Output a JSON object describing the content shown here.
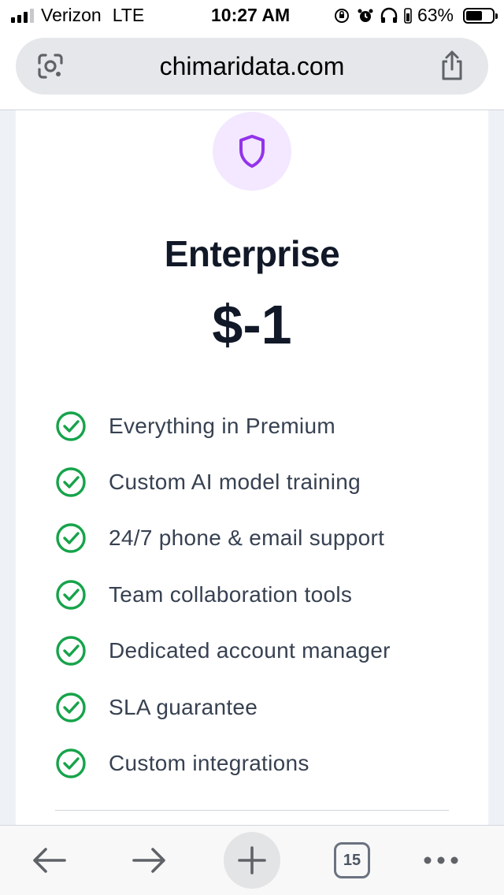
{
  "status_bar": {
    "carrier": "Verizon",
    "network": "LTE",
    "time": "10:27 AM",
    "battery_percent": "63%",
    "battery_level": 0.63
  },
  "browser": {
    "url": "chimaridata.com",
    "tab_count": "15"
  },
  "plan": {
    "icon": "shield-icon",
    "title": "Enterprise",
    "price": "$-1",
    "features": [
      "Everything in Premium",
      "Custom AI model training",
      "24/7 phone & email support",
      "Team collaboration tools",
      "Dedicated account manager",
      "SLA guarantee",
      "Custom integrations"
    ]
  },
  "colors": {
    "accent_purple": "#9333ea",
    "icon_bg": "#f3e8ff",
    "check_green": "#16a34a",
    "title": "#111827",
    "feature_text": "#374151"
  }
}
